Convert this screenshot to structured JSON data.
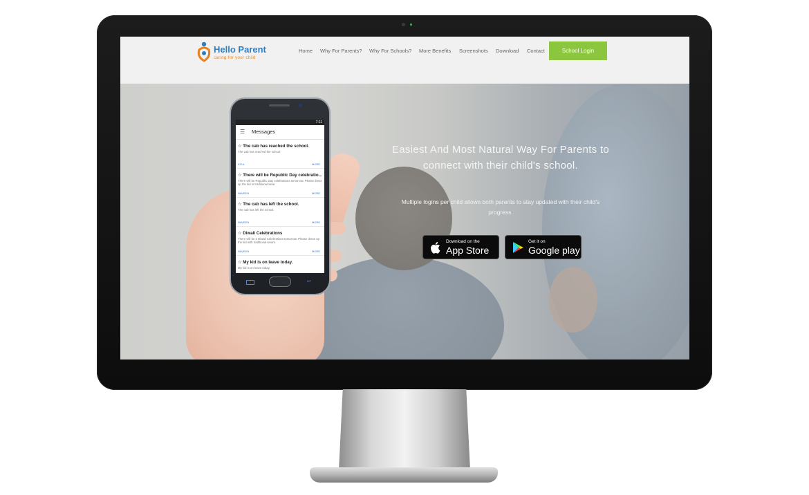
{
  "brand": {
    "name": "Hello Parent",
    "tagline": "caring for your child",
    "colors": {
      "blue": "#2e7fc1",
      "orange": "#e8821e",
      "green": "#8cc63f"
    }
  },
  "nav": {
    "items": [
      "Home",
      "Why For Parents?",
      "Why For Schools?",
      "More Benefits",
      "Screenshots",
      "Download",
      "Contact"
    ],
    "login_button": "School Login"
  },
  "hero": {
    "headline": "Easiest And Most Natural Way For Parents to connect with their child's school.",
    "subline": "Multiple logins per child allows both parents to stay updated with their child's progress."
  },
  "stores": {
    "apple": {
      "small": "Download on the",
      "big": "App Store",
      "icon": "apple-icon"
    },
    "google": {
      "small": "Get it on",
      "big": "Google play",
      "icon": "google-play-icon"
    }
  },
  "phone": {
    "status_time": "7:11",
    "app_title": "Messages",
    "messages": [
      {
        "title": "☆ The cab has reached the school.",
        "body": "The cab has reached the school.",
        "author": "ATUL",
        "more": "MORE"
      },
      {
        "title": "☆ There will be Republic Day celebratio...",
        "body": "There will be Republic Day celebrations tomorrow. Please dress up the kid in traditional wear.",
        "author": "NAVEEN",
        "more": "MORE"
      },
      {
        "title": "☆ The cab has left the school.",
        "body": "The cab has left the school.",
        "author": "NAVEEN",
        "more": "MORE"
      },
      {
        "title": "☆ Diwali Celebrations",
        "body": "There will be a Diwali Celebrations tomorrow. Please dress up the kid with traditional wears.",
        "author": "NAVEEN",
        "more": "MORE"
      },
      {
        "title": "☆ My kid is on leave today.",
        "body": "My kid is on leave today.",
        "author": "",
        "more": ""
      }
    ]
  }
}
